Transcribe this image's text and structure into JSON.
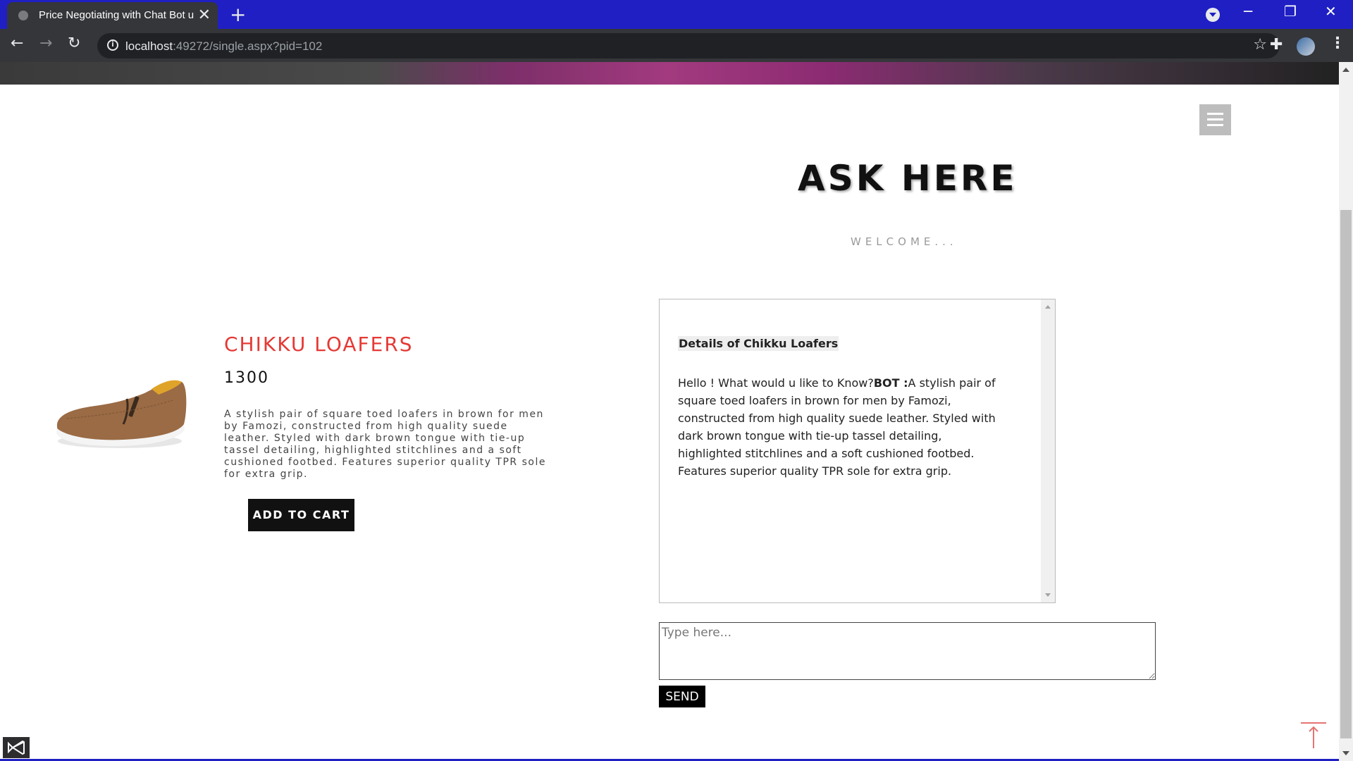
{
  "browser": {
    "tab_title": "Price Negotiating with Chat Bot u",
    "tab_close": "✕",
    "new_tab": "+",
    "url_host": "localhost",
    "url_path": ":49272/single.aspx?pid=102",
    "minimize": "─",
    "restore": "❐",
    "close": "✕"
  },
  "page": {
    "heading": "ASK HERE",
    "subheading": "WELCOME...",
    "product": {
      "name": "CHIKKU LOAFERS",
      "price": "1300",
      "description": "A stylish pair of square toed loafers in brown for men by Famozi, constructed from high quality suede leather. Styled with dark brown tongue with tie-up tassel detailing, highlighted stitchlines and a soft cushioned footbed. Features superior quality TPR sole for extra grip.",
      "add_to_cart": "ADD TO CART"
    },
    "chat": {
      "heading": "Details of Chikku Loafers",
      "user_text": "Hello ! What would u like to Know?",
      "bot_label": "BOT :",
      "bot_text": "A stylish pair of square toed loafers in brown for men by Famozi, constructed from high quality suede leather. Styled with dark brown tongue with tie-up tassel detailing, highlighted stitchlines and a soft cushioned footbed. Features superior quality TPR sole for extra grip.",
      "input_placeholder": "Type here...",
      "send_label": "SEND"
    }
  },
  "colors": {
    "tab_strip": "#1f1fc4",
    "product_name": "#e53935",
    "to_top_arrow": "#e57373"
  }
}
